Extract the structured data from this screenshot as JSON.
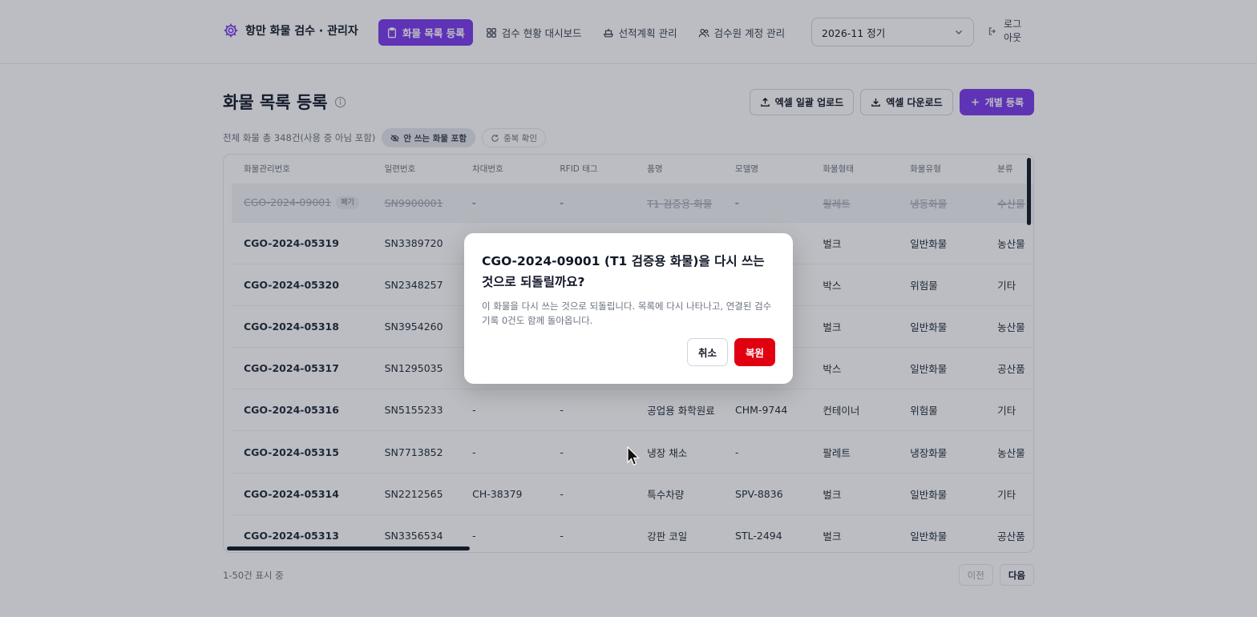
{
  "header": {
    "brand": "항만 화물 검수 · 관리자",
    "nav": [
      {
        "label": "화물 목록 등록",
        "active": true,
        "icon": "clipboard-icon"
      },
      {
        "label": "검수 현황 대시보드",
        "active": false,
        "icon": "dashboard-icon"
      },
      {
        "label": "선적계획 관리",
        "active": false,
        "icon": "ship-icon"
      },
      {
        "label": "검수원 계정 관리",
        "active": false,
        "icon": "users-icon"
      }
    ],
    "period_select": {
      "value": "2026-11 정기"
    },
    "logout_label": "로그아웃"
  },
  "page": {
    "title": "화물 목록 등록",
    "actions": {
      "upload": "엑셀 일괄 업로드",
      "download": "엑셀 다운로드",
      "add": "개별 등록"
    },
    "summary": "전체 화물 총 348건(사용 중 아님 포함)",
    "chips": {
      "include_unused": "안 쓰는 화물 포함",
      "dup_check": "중복 확인"
    }
  },
  "table": {
    "columns": [
      "화물관리번호",
      "일련번호",
      "차대번호",
      "RFID 태그",
      "품명",
      "모델명",
      "화물형태",
      "화물유형",
      "분류"
    ],
    "discarded_row": {
      "cells": [
        "CGO-2024-09001",
        "SN9900001",
        "-",
        "-",
        "T1 검증용 화물",
        "-",
        "팔레트",
        "냉동화물",
        "수산물"
      ],
      "badge": "폐기"
    },
    "rows": [
      [
        "CGO-2024-05319",
        "SN3389720",
        "",
        "",
        "",
        "",
        "벌크",
        "일반화물",
        "농산물"
      ],
      [
        "CGO-2024-05320",
        "SN2348257",
        "",
        "",
        "",
        "",
        "박스",
        "위험물",
        "기타"
      ],
      [
        "CGO-2024-05318",
        "SN3954260",
        "",
        "",
        "",
        "",
        "벌크",
        "일반화물",
        "농산물"
      ],
      [
        "CGO-2024-05317",
        "SN1295035",
        "",
        "",
        "",
        "",
        "박스",
        "일반화물",
        "공산품"
      ],
      [
        "CGO-2024-05316",
        "SN5155233",
        "-",
        "-",
        "공업용 화학원료",
        "CHM-9744",
        "컨테이너",
        "위험물",
        "기타"
      ],
      [
        "CGO-2024-05315",
        "SN7713852",
        "-",
        "-",
        "냉장 채소",
        "-",
        "팔레트",
        "냉장화물",
        "농산물"
      ],
      [
        "CGO-2024-05314",
        "SN2212565",
        "CH-38379",
        "-",
        "특수차량",
        "SPV-8836",
        "벌크",
        "일반화물",
        "기타"
      ],
      [
        "CGO-2024-05313",
        "SN3356534",
        "-",
        "-",
        "강판 코일",
        "STL-2494",
        "벌크",
        "일반화물",
        "공산품"
      ]
    ]
  },
  "footer": {
    "info": "1-50건 표시 중",
    "prev": "이전",
    "next": "다음"
  },
  "dialog": {
    "title": "CGO-2024-09001 (T1 검증용 화물)을 다시 쓰는 것으로 되돌릴까요?",
    "description": "이 화물을 다시 쓰는 것으로 되돌립니다. 목록에 다시 나타나고, 연결된 검수 기록 0건도 함께 돌아옵니다.",
    "cancel": "취소",
    "confirm": "복원"
  },
  "colors": {
    "accent": "#7c3aed",
    "danger": "#e00010"
  }
}
